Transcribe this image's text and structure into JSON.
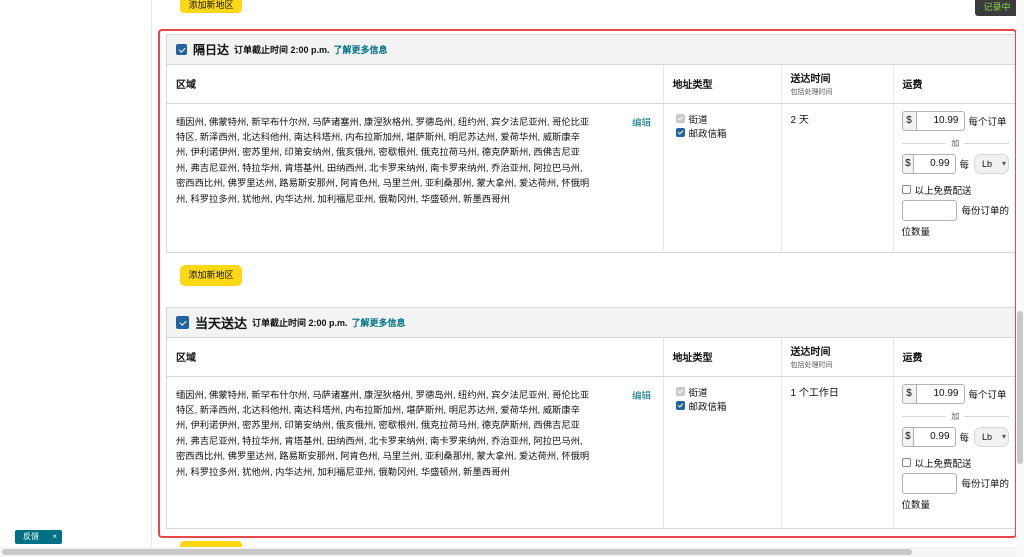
{
  "top": {
    "add_region_label": "添加新地区",
    "recording_label": "记录中"
  },
  "sections": [
    {
      "title": "隔日达",
      "cutoff": "订单截止时间 2:00 p.m.",
      "learn_more": "了解更多信息",
      "headers": {
        "region": "区域",
        "address_type": "地址类型",
        "transit": "送达时间",
        "transit_sub": "包括处理时间",
        "fee": "运费"
      },
      "region_text": "缅因州, 佛蒙特州, 新罕布什尔州, 马萨诸塞州, 康涅狄格州, 罗德岛州, 纽约州, 宾夕法尼亚州, 哥伦比亚特区, 新泽西州, 北达科他州, 南达科塔州, 内布拉斯加州, 堪萨斯州, 明尼苏达州, 爱荷华州, 威斯康辛州, 伊利诺伊州, 密苏里州, 印第安纳州, 俄亥俄州, 密歇根州, 俄克拉荷马州, 德克萨斯州, 西佛吉尼亚州, 弗吉尼亚州, 特拉华州, 肯塔基州, 田纳西州, 北卡罗来纳州, 南卡罗来纳州, 乔治亚州, 阿拉巴马州, 密西西比州, 佛罗里达州, 路易斯安那州, 阿肯色州, 马里兰州, 亚利桑那州, 蒙大拿州, 爱达荷州, 怀俄明州, 科罗拉多州, 犹他州, 内华达州, 加利福尼亚州, 俄勒冈州, 华盛顿州, 新墨西哥州",
      "edit": "编辑",
      "addr_street": "街道",
      "addr_po": "邮政信箱",
      "transit_value": "2 天",
      "currency": "$",
      "per_order_fee": "10.99",
      "per_order_label": "每个订单",
      "plus": "加",
      "per_unit_fee": "0.99",
      "per_unit_label": "每",
      "unit": "Lb",
      "free_label": "以上免费配送",
      "min_label": "每份订单的",
      "min_unit": "位数量",
      "add_region_label": "添加新地区"
    },
    {
      "title": "当天送达",
      "cutoff": "订单截止时间 2:00 p.m.",
      "learn_more": "了解更多信息",
      "headers": {
        "region": "区域",
        "address_type": "地址类型",
        "transit": "送达时间",
        "transit_sub": "包括处理时间",
        "fee": "运费"
      },
      "region_text": "缅因州, 佛蒙特州, 新罕布什尔州, 马萨诸塞州, 康涅狄格州, 罗德岛州, 纽约州, 宾夕法尼亚州, 哥伦比亚特区, 新泽西州, 北达科他州, 南达科塔州, 内布拉斯加州, 堪萨斯州, 明尼苏达州, 爱荷华州, 威斯康辛州, 伊利诺伊州, 密苏里州, 印第安纳州, 俄亥俄州, 密歇根州, 俄克拉荷马州, 德克萨斯州, 西佛吉尼亚州, 弗吉尼亚州, 特拉华州, 肯塔基州, 田纳西州, 北卡罗来纳州, 南卡罗来纳州, 乔治亚州, 阿拉巴马州, 密西西比州, 佛罗里达州, 路易斯安那州, 阿肯色州, 马里兰州, 亚利桑那州, 蒙大拿州, 爱达荷州, 怀俄明州, 科罗拉多州, 犹他州, 内华达州, 加利福尼亚州, 俄勒冈州, 华盛顿州, 新墨西哥州",
      "edit": "编辑",
      "addr_street": "街道",
      "addr_po": "邮政信箱",
      "transit_value": "1 个工作日",
      "currency": "$",
      "per_order_fee": "10.99",
      "per_order_label": "每个订单",
      "plus": "加",
      "per_unit_fee": "0.99",
      "per_unit_label": "每",
      "unit": "Lb",
      "free_label": "以上免费配送",
      "min_label": "每份订单的",
      "min_unit": "位数量"
    }
  ],
  "feedback": {
    "label": "反馈",
    "close": "×"
  },
  "colors": {
    "accent_yellow": "#ffd814",
    "link_teal": "#007185",
    "checkbox_blue": "#2162a1",
    "highlight_red": "#e9474b"
  }
}
